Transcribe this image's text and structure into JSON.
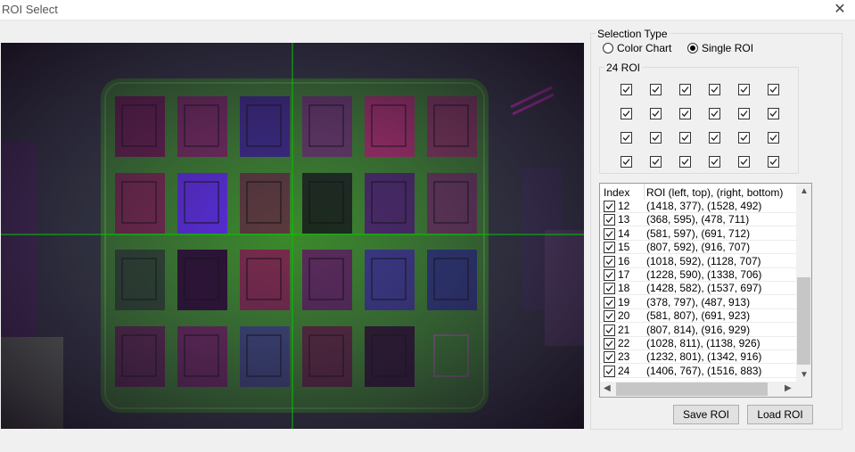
{
  "window": {
    "title": "ROI Select",
    "close_label": "✕"
  },
  "selection_type": {
    "label": "Selection  Type",
    "options": [
      {
        "label": "Color Chart",
        "checked": false
      },
      {
        "label": "Single ROI",
        "checked": true
      }
    ]
  },
  "roi_grid": {
    "label": "24 ROI",
    "checked": true
  },
  "roi_table": {
    "headers": [
      "Index",
      "ROI (left, top), (right, bottom)"
    ],
    "rows": [
      {
        "index": "12",
        "roi": "(1418, 377), (1528, 492)",
        "checked": true
      },
      {
        "index": "13",
        "roi": "(368, 595), (478, 711)",
        "checked": true
      },
      {
        "index": "14",
        "roi": "(581, 597), (691, 712)",
        "checked": true
      },
      {
        "index": "15",
        "roi": "(807, 592), (916, 707)",
        "checked": true
      },
      {
        "index": "16",
        "roi": "(1018, 592), (1128, 707)",
        "checked": true
      },
      {
        "index": "17",
        "roi": "(1228, 590), (1338, 706)",
        "checked": true
      },
      {
        "index": "18",
        "roi": "(1428, 582), (1537, 697)",
        "checked": true
      },
      {
        "index": "19",
        "roi": "(378, 797), (487, 913)",
        "checked": true
      },
      {
        "index": "20",
        "roi": "(581, 807), (691, 923)",
        "checked": true
      },
      {
        "index": "21",
        "roi": "(807, 814), (916, 929)",
        "checked": true
      },
      {
        "index": "22",
        "roi": "(1028, 811), (1138, 926)",
        "checked": true
      },
      {
        "index": "23",
        "roi": "(1232, 801), (1342, 916)",
        "checked": true
      },
      {
        "index": "24",
        "roi": "(1406, 767), (1516, 883)",
        "checked": true
      }
    ]
  },
  "buttons": {
    "save": "Save ROI",
    "load": "Load ROI"
  },
  "colors": {
    "crosshair": "#00c800",
    "selected_roi": "#d060d0",
    "roi_box": "#111111",
    "chart_frame": "#3b8a2a"
  }
}
